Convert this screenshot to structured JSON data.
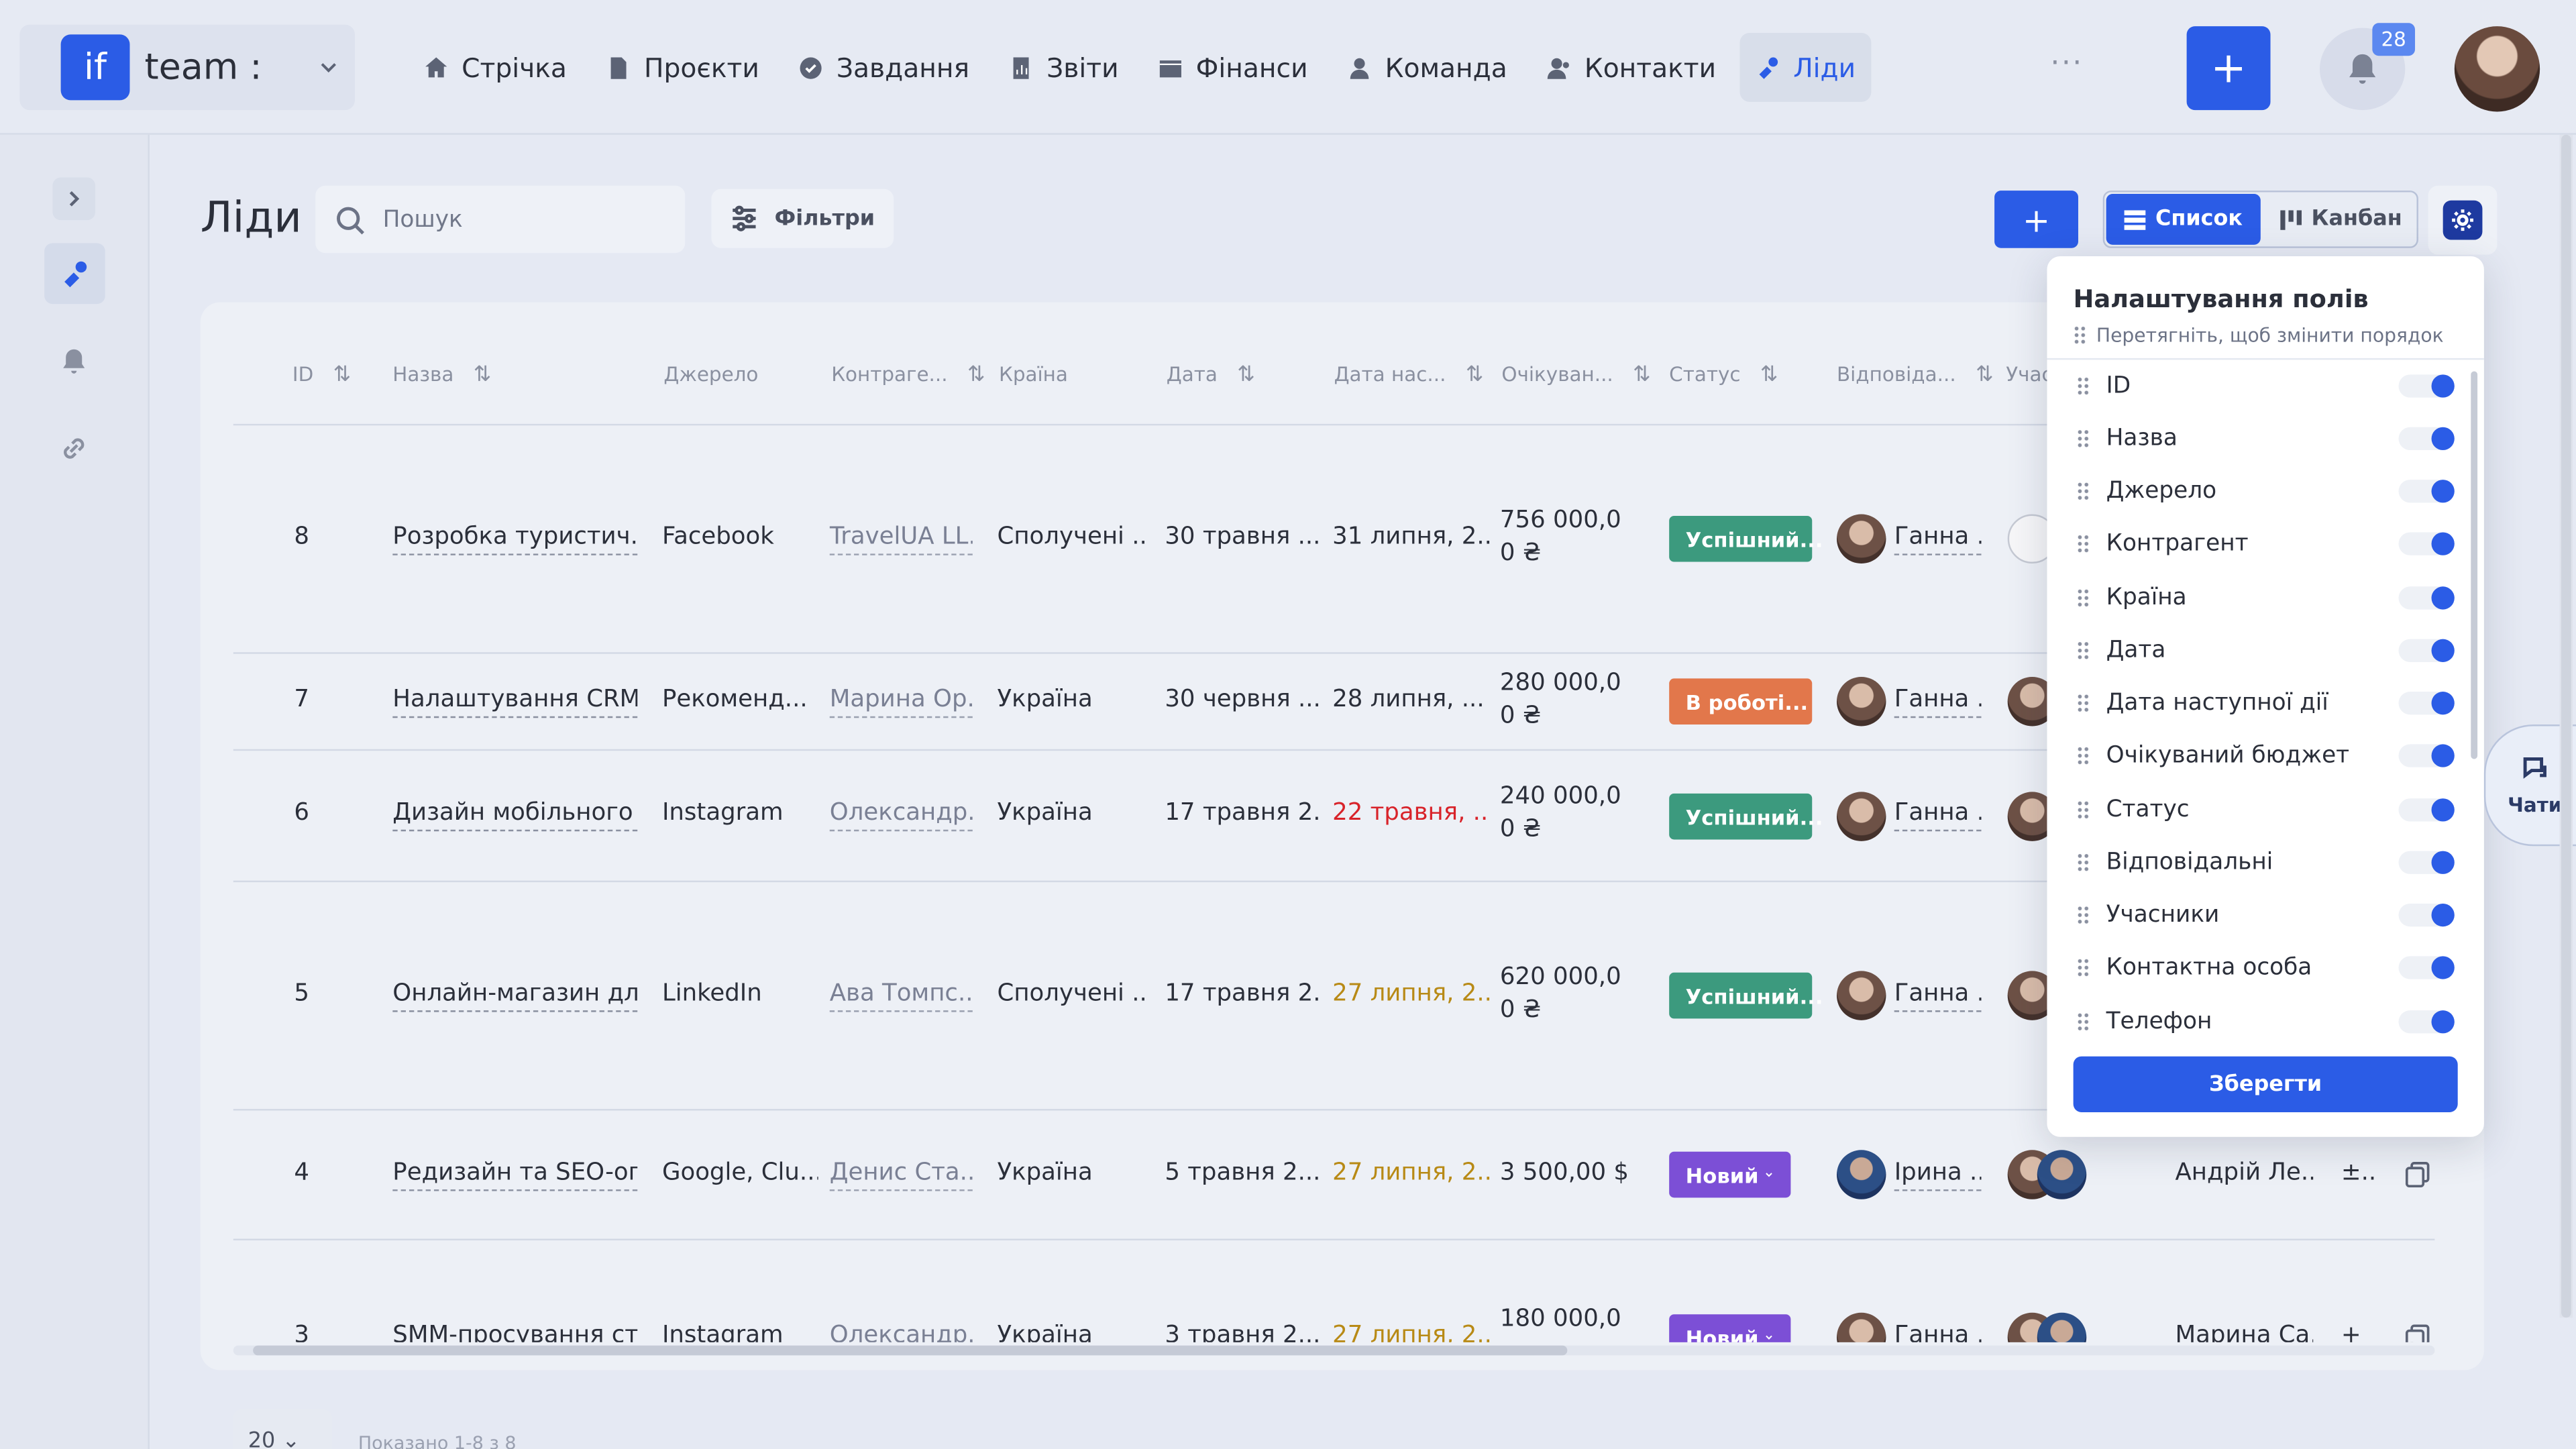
{
  "brand": {
    "logo": "if",
    "name": "team :"
  },
  "nav": [
    {
      "label": "Стрічка",
      "icon": "home-icon"
    },
    {
      "label": "Проєкти",
      "icon": "file-icon"
    },
    {
      "label": "Завдання",
      "icon": "check-circle-icon"
    },
    {
      "label": "Звіти",
      "icon": "report-icon"
    },
    {
      "label": "Фінанси",
      "icon": "wallet-icon"
    },
    {
      "label": "Команда",
      "icon": "person-icon"
    },
    {
      "label": "Контакти",
      "icon": "contacts-icon"
    },
    {
      "label": "Ліди",
      "icon": "leads-icon",
      "active": true
    }
  ],
  "nav_more": "···",
  "header": {
    "plus": "+",
    "notifications_count": "28"
  },
  "page": {
    "title": "Ліди",
    "search_placeholder": "Пошук",
    "filters_label": "Фільтри",
    "add_label": "+",
    "view_list": "Список",
    "view_kanban": "Канбан"
  },
  "table": {
    "headers": [
      "ID",
      "Назва",
      "Джерело",
      "Контраге...",
      "Країна",
      "Дата",
      "Дата нас...",
      "Очікуван...",
      "Статус",
      "Відповіда...",
      "Учас"
    ],
    "rows": [
      {
        "id": "8",
        "name": "Розробка туристич...",
        "source": "Facebook",
        "contractor": "TravelUA LL...",
        "country": "Сполучені ...",
        "date": "30 травня ...",
        "next_date": "31 липня, 2...",
        "budget1": "756 000,0",
        "budget2": "0 ₴",
        "status": "Успішний...",
        "owner": "Ганна ..."
      },
      {
        "id": "7",
        "name": "Налаштування CRM ...",
        "source": "Рекоменд...",
        "contractor": "Марина Ор...",
        "country": "Україна",
        "date": "30 червня ...",
        "next_date": "28 липня, ...",
        "budget1": "280 000,0",
        "budget2": "0 ₴",
        "status": "В роботі...",
        "owner": "Ганна ..."
      },
      {
        "id": "6",
        "name": "Дизайн мобільного ...",
        "source": "Instagram",
        "contractor": "Олександр...",
        "country": "Україна",
        "date": "17 травня 2...",
        "next_date": "22 травня, ...",
        "budget1": "240 000,0",
        "budget2": "0 ₴",
        "status": "Успішний...",
        "owner": "Ганна ..."
      },
      {
        "id": "5",
        "name": "Онлайн-магазин дл...",
        "source": "LinkedIn",
        "contractor": "Ава Томпс...",
        "country": "Сполучені ...",
        "date": "17 травня 2...",
        "next_date": "27 липня, 2...",
        "budget1": "620 000,0",
        "budget2": "0 ₴",
        "status": "Успішний...",
        "owner": "Ганна ..."
      },
      {
        "id": "4",
        "name": "Редизайн та SEO-оп...",
        "source": "Google, Clu...",
        "contractor": "Денис Ста...",
        "country": "Україна",
        "date": "5 травня 2...",
        "next_date": "27 липня, 2...",
        "budget1": "3 500,00 $",
        "budget2": "",
        "status": "Новий",
        "owner": "Ірина ...",
        "contact": "Андрій Ле...",
        "phone": "±..."
      },
      {
        "id": "3",
        "name": "SMM-просування ст...",
        "source": "Instagram",
        "contractor": "Олександр...",
        "country": "Україна",
        "date": "3 травня 2...",
        "next_date": "27 липня, 2...",
        "budget1": "180 000,0",
        "budget2": "",
        "status": "Новий",
        "owner": "Ганна ...",
        "contact": "Марина Са...",
        "phone": "+"
      }
    ]
  },
  "pager": {
    "size": "20",
    "shown": "Показано 1-8 з 8"
  },
  "panel": {
    "title": "Налаштування полів",
    "hint": "Перетягніть, щоб змінити порядок",
    "fields": [
      "ID",
      "Назва",
      "Джерело",
      "Контрагент",
      "Країна",
      "Дата",
      "Дата наступної дії",
      "Очікуваний бюджет",
      "Статус",
      "Відповідальні",
      "Учасники",
      "Контактна особа",
      "Телефон"
    ],
    "save": "Зберегти"
  },
  "chat": {
    "label": "Чати"
  },
  "colors": {
    "accent": "#2b5ce6",
    "success": "#3c9a7e",
    "in_progress": "#e2774b",
    "new": "#7c4fd6",
    "overdue": "#d8232a",
    "soon": "#b88a16"
  }
}
